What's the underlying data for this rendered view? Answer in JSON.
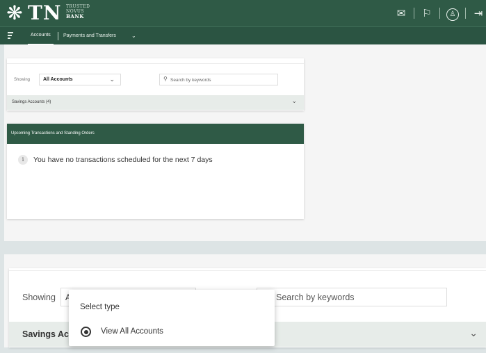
{
  "header": {
    "logo_mark": "❋",
    "logo_text": "TN",
    "logo_sub": [
      "TRUSTED",
      "NOVUS",
      "BANK"
    ],
    "icons": [
      "mail-icon",
      "flag-icon",
      "user-icon",
      "logout-icon"
    ]
  },
  "nav": {
    "menu_icon": "hamburger-icon",
    "accounts": "Accounts",
    "payments": "Payments and Transfers",
    "payments_chevron": "⌄"
  },
  "accounts_card": {
    "showing_label": "Showing",
    "filter_value": "All Accounts",
    "search_placeholder": "Search by keywords",
    "savings_label": "Savings Accounts (4)"
  },
  "upcoming": {
    "title": "Upcoming Transactions and Standing Orders",
    "info_icon": "i",
    "message": "You have no transactions scheduled for the next 7 days"
  },
  "zoomed": {
    "showing_label": "Showing",
    "filter_value_partial": "A",
    "search_placeholder": "Search by keywords",
    "savings_label_partial": "Savings Acc"
  },
  "dropdown": {
    "title": "Select type",
    "option": "View All Accounts",
    "selected": true
  },
  "colors": {
    "brand_green": "#2f5a46",
    "savings_bar": "#e7ece9"
  }
}
